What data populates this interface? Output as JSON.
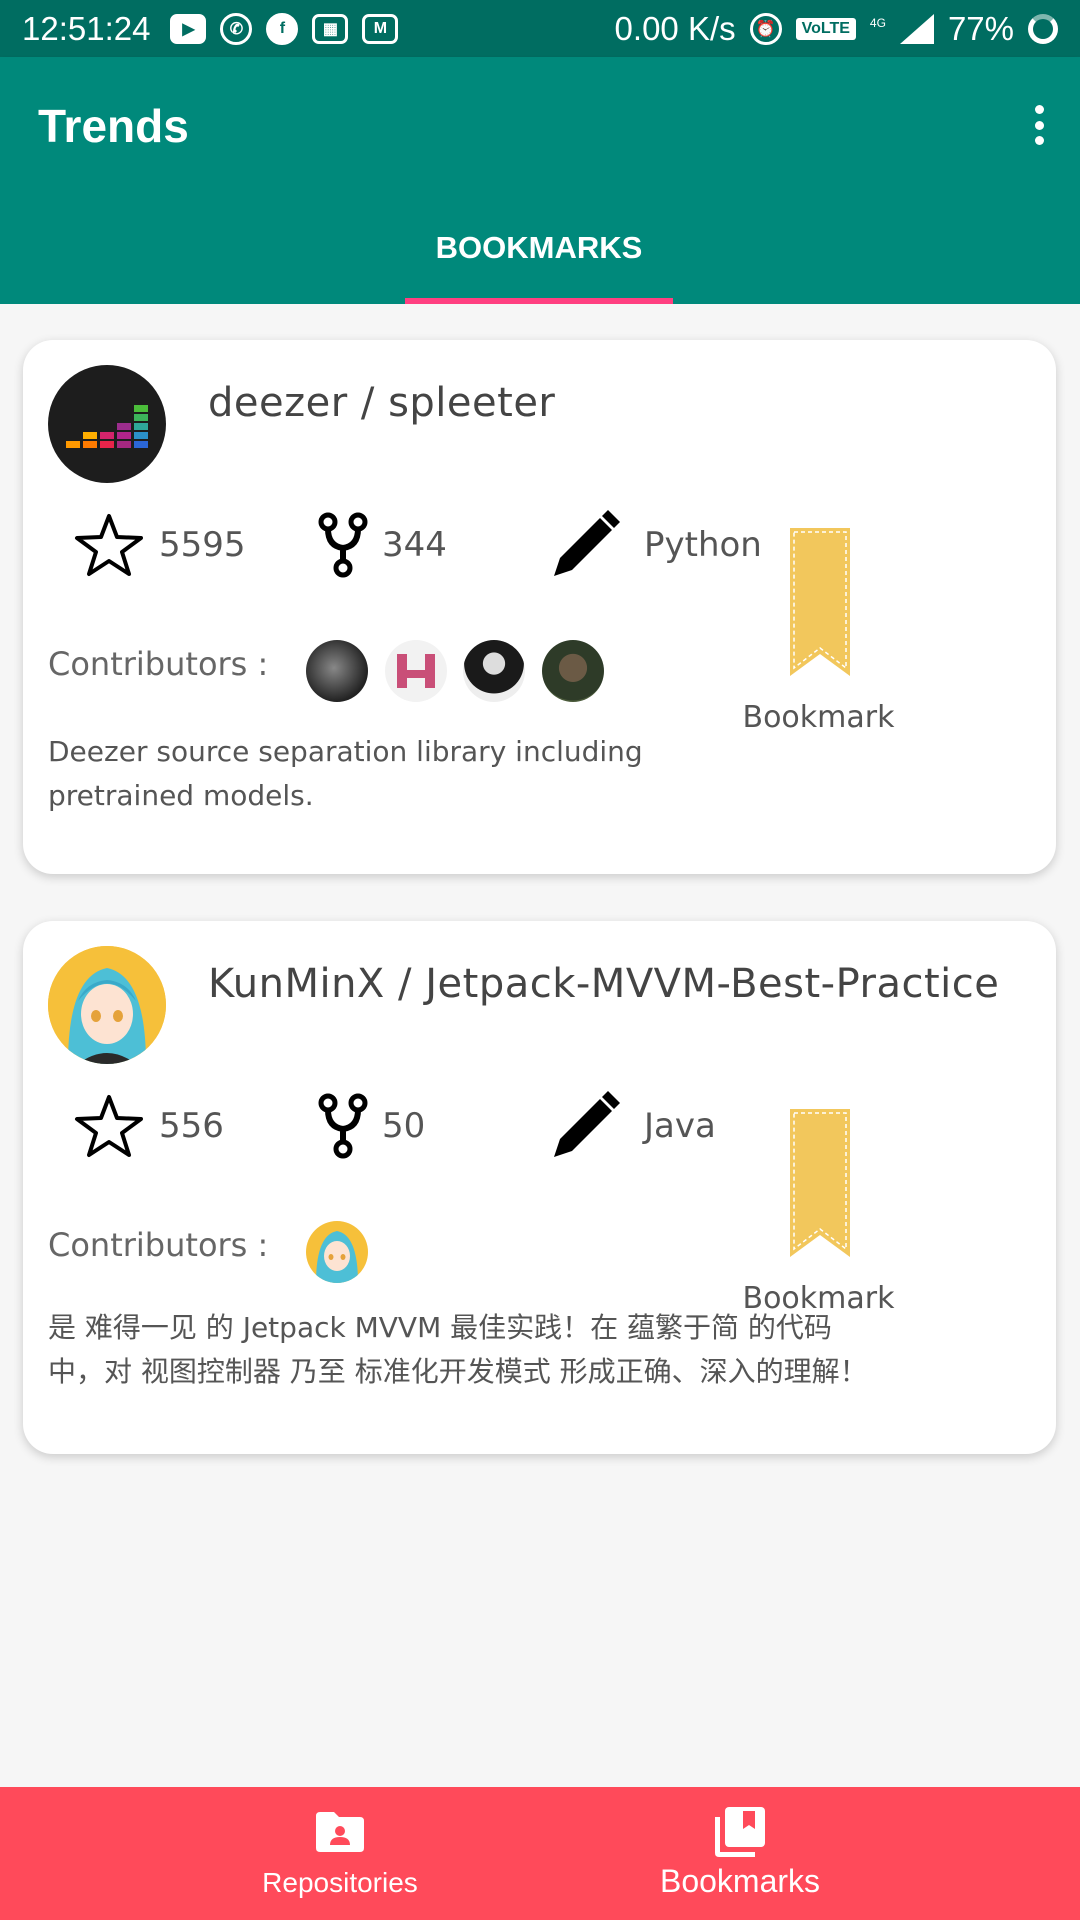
{
  "status_bar": {
    "time": "12:51:24",
    "net_speed": "0.00 K/s",
    "volte": "VoLTE",
    "network": "4G",
    "battery": "77%"
  },
  "app_bar": {
    "title": "Trends"
  },
  "tabs": [
    {
      "label": "BOOKMARKS",
      "selected": true
    }
  ],
  "accent_colors": {
    "primary": "#00897b",
    "primary_dark": "#006d61",
    "indicator": "#ff4081",
    "bottom_nav": "#ff4a5a",
    "bookmark": "#f2c75c"
  },
  "repos": [
    {
      "name": "deezer / spleeter",
      "stars": "5595",
      "forks": "344",
      "language": "Python",
      "contributors_label": "Contributors :",
      "description": "Deezer source separation library including pretrained models.",
      "bookmark_label": "Bookmark"
    },
    {
      "name": "KunMinX / Jetpack-MVVM-Best-Practice",
      "stars": "556",
      "forks": "50",
      "language": "Java",
      "contributors_label": "Contributors :",
      "description": "是 难得一见 的 Jetpack MVVM 最佳实践！在 蕴繁于简 的代码中，对 视图控制器 乃至 标准化开发模式 形成正确、深入的理解！",
      "bookmark_label": "Bookmark"
    }
  ],
  "bottom_nav": [
    {
      "label": "Repositories",
      "icon": "folder-person-icon",
      "selected": false
    },
    {
      "label": "Bookmarks",
      "icon": "library-books-icon",
      "selected": true
    }
  ]
}
